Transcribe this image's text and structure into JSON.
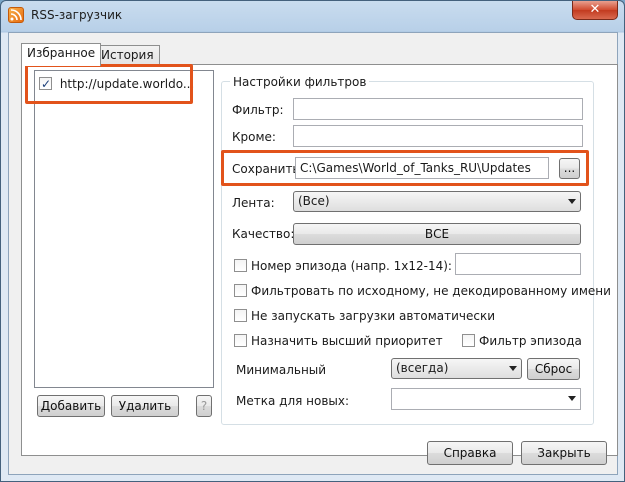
{
  "window": {
    "title": "RSS-загрузчик",
    "close_glyph": "✕"
  },
  "tabs": [
    {
      "label": "Избранное",
      "active": true
    },
    {
      "label": "История",
      "active": false
    }
  ],
  "feeds": [
    {
      "label": "http://update.worldo...",
      "checked": true
    }
  ],
  "feed_buttons": {
    "add": "Добавить",
    "remove": "Удалить",
    "help": "?"
  },
  "filters": {
    "group_title": "Настройки фильтров",
    "filter_label": "Фильтр:",
    "filter_value": "",
    "except_label": "Кроме:",
    "except_value": "",
    "save_label": "Сохранить",
    "save_path": "C:\\Games\\World_of_Tanks_RU\\Updates",
    "browse_button": "...",
    "feed_label": "Лента:",
    "feed_value": "(Все)",
    "quality_label": "Качество:",
    "quality_button": "ВСЕ",
    "episode_number_label": "Номер эпизода (напр. 1x12-14):",
    "episode_number_value": "",
    "filter_original_label": "Фильтровать по исходному, не декодированному имени",
    "no_auto_start_label": "Не запускать загрузки автоматически",
    "high_priority_label": "Назначить высший приоритет",
    "episode_filter_label": "Фильтр эпизода",
    "minimal_label": "Минимальный",
    "minimal_value": "(всегда)",
    "reset_button": "Сброс",
    "label_for_new": "Метка для новых:",
    "label_for_new_value": ""
  },
  "footer": {
    "help": "Справка",
    "close": "Закрыть"
  },
  "colors": {
    "highlight": "#e2531b",
    "title_bar": "#b8d0e8"
  }
}
